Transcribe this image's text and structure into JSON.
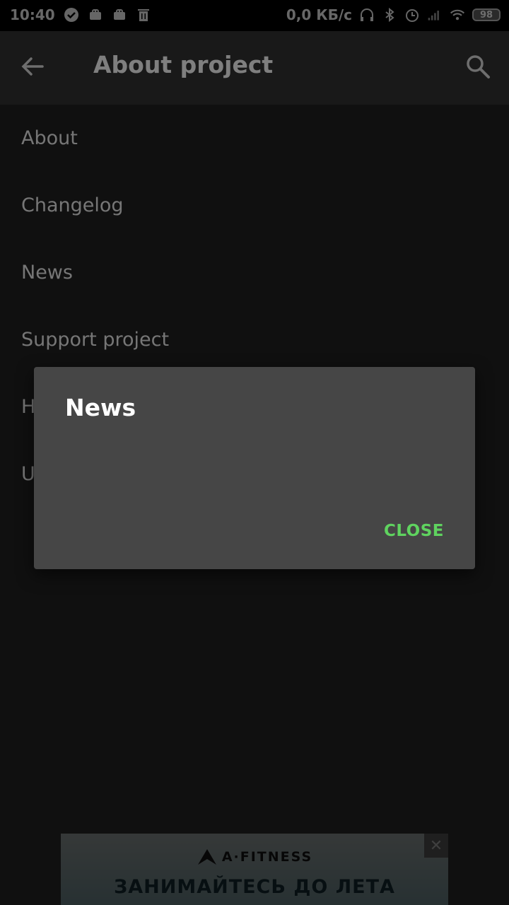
{
  "status_bar": {
    "time": "10:40",
    "network_speed": "0,0 КБ/с",
    "battery_level": "98",
    "icons": [
      "check-circle-icon",
      "android-icon",
      "android-icon",
      "trash-icon",
      "headphones-icon",
      "bluetooth-icon",
      "alarm-icon",
      "signal-icon",
      "wifi-icon",
      "battery-icon"
    ]
  },
  "app_bar": {
    "title": "About project",
    "back_icon": "arrow-back-icon",
    "search_icon": "search-icon"
  },
  "menu": {
    "items": [
      {
        "label": "About"
      },
      {
        "label": "Changelog"
      },
      {
        "label": "News"
      },
      {
        "label": "Support project"
      },
      {
        "label": "H"
      },
      {
        "label": "U"
      }
    ]
  },
  "dialog": {
    "title": "News",
    "close_label": "CLOSE"
  },
  "ad": {
    "brand": "A·FITNESS",
    "headline": "ЗАНИМАЙТЕСЬ ДО ЛЕТА",
    "close_icon": "close-icon"
  },
  "colors": {
    "background": "#202020",
    "app_bar": "#333333",
    "dialog": "#464646",
    "accent": "#5fd35f"
  }
}
